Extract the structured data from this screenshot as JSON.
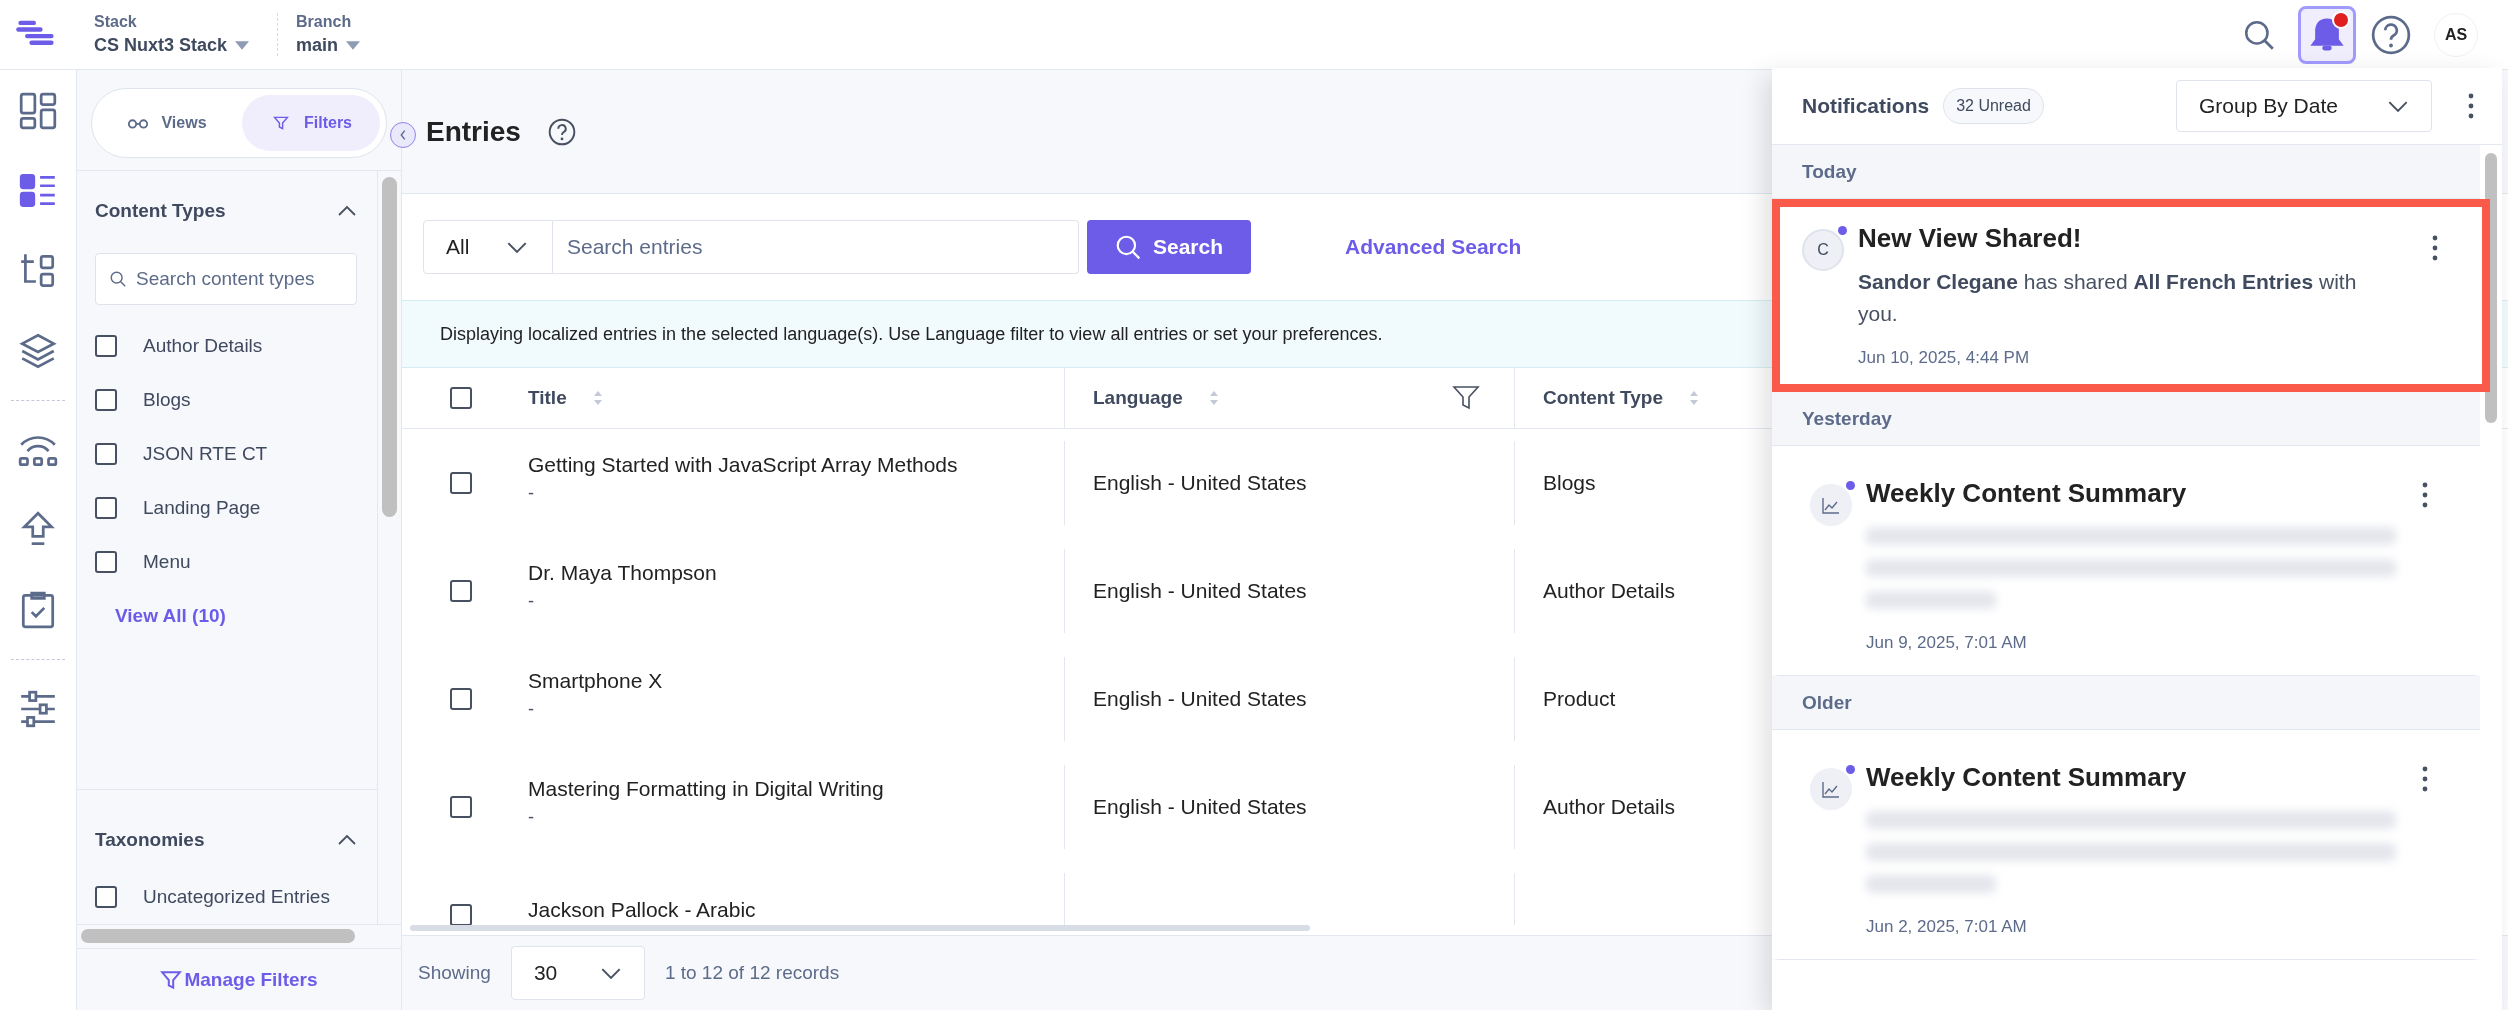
{
  "header": {
    "stack_label": "Stack",
    "stack": "CS Nuxt3 Stack",
    "branch_label": "Branch",
    "branch": "main",
    "avatar": "AS",
    "bell_active": true,
    "bell_unread": true
  },
  "nav_rail": [
    {
      "kind": "dashboard",
      "selected": false
    },
    {
      "kind": "entries",
      "selected": true
    },
    {
      "kind": "content-model",
      "selected": false
    },
    {
      "kind": "layers",
      "selected": false
    },
    {
      "kind": "releases",
      "selected": false
    },
    {
      "kind": "publish",
      "selected": false
    },
    {
      "kind": "tasks",
      "selected": false
    },
    {
      "kind": "settings",
      "selected": false
    }
  ],
  "filter_panel": {
    "tabs": [
      {
        "kind": "views",
        "label": "Views",
        "selected": false
      },
      {
        "kind": "filters",
        "label": "Filters",
        "selected": true
      }
    ],
    "sections": [
      {
        "title": "Content Types",
        "expanded": true,
        "search_placeholder": "Search content types",
        "view_all": "View All (10)",
        "items": [
          {
            "label": "Author Details",
            "checked": false
          },
          {
            "label": "Blogs",
            "checked": false
          },
          {
            "label": "JSON RTE CT",
            "checked": false
          },
          {
            "label": "Landing Page",
            "checked": false
          },
          {
            "label": "Menu",
            "checked": false
          }
        ]
      },
      {
        "title": "Taxonomies",
        "expanded": true,
        "items": [
          {
            "label": "Uncategorized Entries",
            "checked": false
          }
        ]
      }
    ],
    "manage_filters": "Manage Filters"
  },
  "entries": {
    "title": "Entries",
    "locale_filter": "All",
    "search_placeholder": "Search entries",
    "search_button": "Search",
    "advanced_search": "Advanced Search",
    "banner": "Displaying localized entries in the selected language(s). Use Language filter to view all entries or set your preferences.",
    "table": {
      "select_all_checked": false,
      "columns": [
        {
          "label": "Title",
          "sortable": true,
          "filterable": false
        },
        {
          "label": "Language",
          "sortable": true,
          "filterable": true
        },
        {
          "label": "Content Type",
          "sortable": true,
          "filterable": false
        }
      ],
      "rows": [
        {
          "title": "Getting Started with JavaScript Array Methods",
          "subtitle": "-",
          "language": "English - United States",
          "content_type": "Blogs",
          "checked": false
        },
        {
          "title": "Dr. Maya Thompson",
          "subtitle": "-",
          "language": "English - United States",
          "content_type": "Author Details",
          "checked": false
        },
        {
          "title": "Smartphone X",
          "subtitle": "-",
          "language": "English - United States",
          "content_type": "Product",
          "checked": false
        },
        {
          "title": "Mastering Formatting in Digital Writing",
          "subtitle": "-",
          "language": "English - United States",
          "content_type": "Author Details",
          "checked": false
        },
        {
          "title": "Jackson Pallock - Arabic",
          "checked": false
        }
      ]
    },
    "footer": {
      "showing_label": "Showing",
      "page_size": "30",
      "range": "1 to 12 of 12 records"
    }
  },
  "notifications": {
    "title": "Notifications",
    "unread": "32 Unread",
    "group_by": "Group By Date",
    "groups": [
      {
        "label": "Today",
        "items": [
          {
            "kind": "user",
            "avatar": "C",
            "title": "New View Shared!",
            "message": "**Sandor Clegane** has shared **All French Entries** with you.",
            "blurred": false,
            "time": "Jun 10, 2025, 4:44 PM",
            "unread": true,
            "highlighted": true
          }
        ]
      },
      {
        "label": "Yesterday",
        "items": [
          {
            "kind": "summary",
            "title": "Weekly Content Summary",
            "blurred": true,
            "time": "Jun 9, 2025, 7:01 AM",
            "unread": true,
            "highlighted": false
          }
        ]
      },
      {
        "label": "Older",
        "items": [
          {
            "kind": "summary",
            "title": "Weekly Content Summary",
            "blurred": true,
            "time": "Jun 2, 2025, 7:01 AM",
            "unread": true,
            "highlighted": false
          }
        ]
      }
    ]
  }
}
